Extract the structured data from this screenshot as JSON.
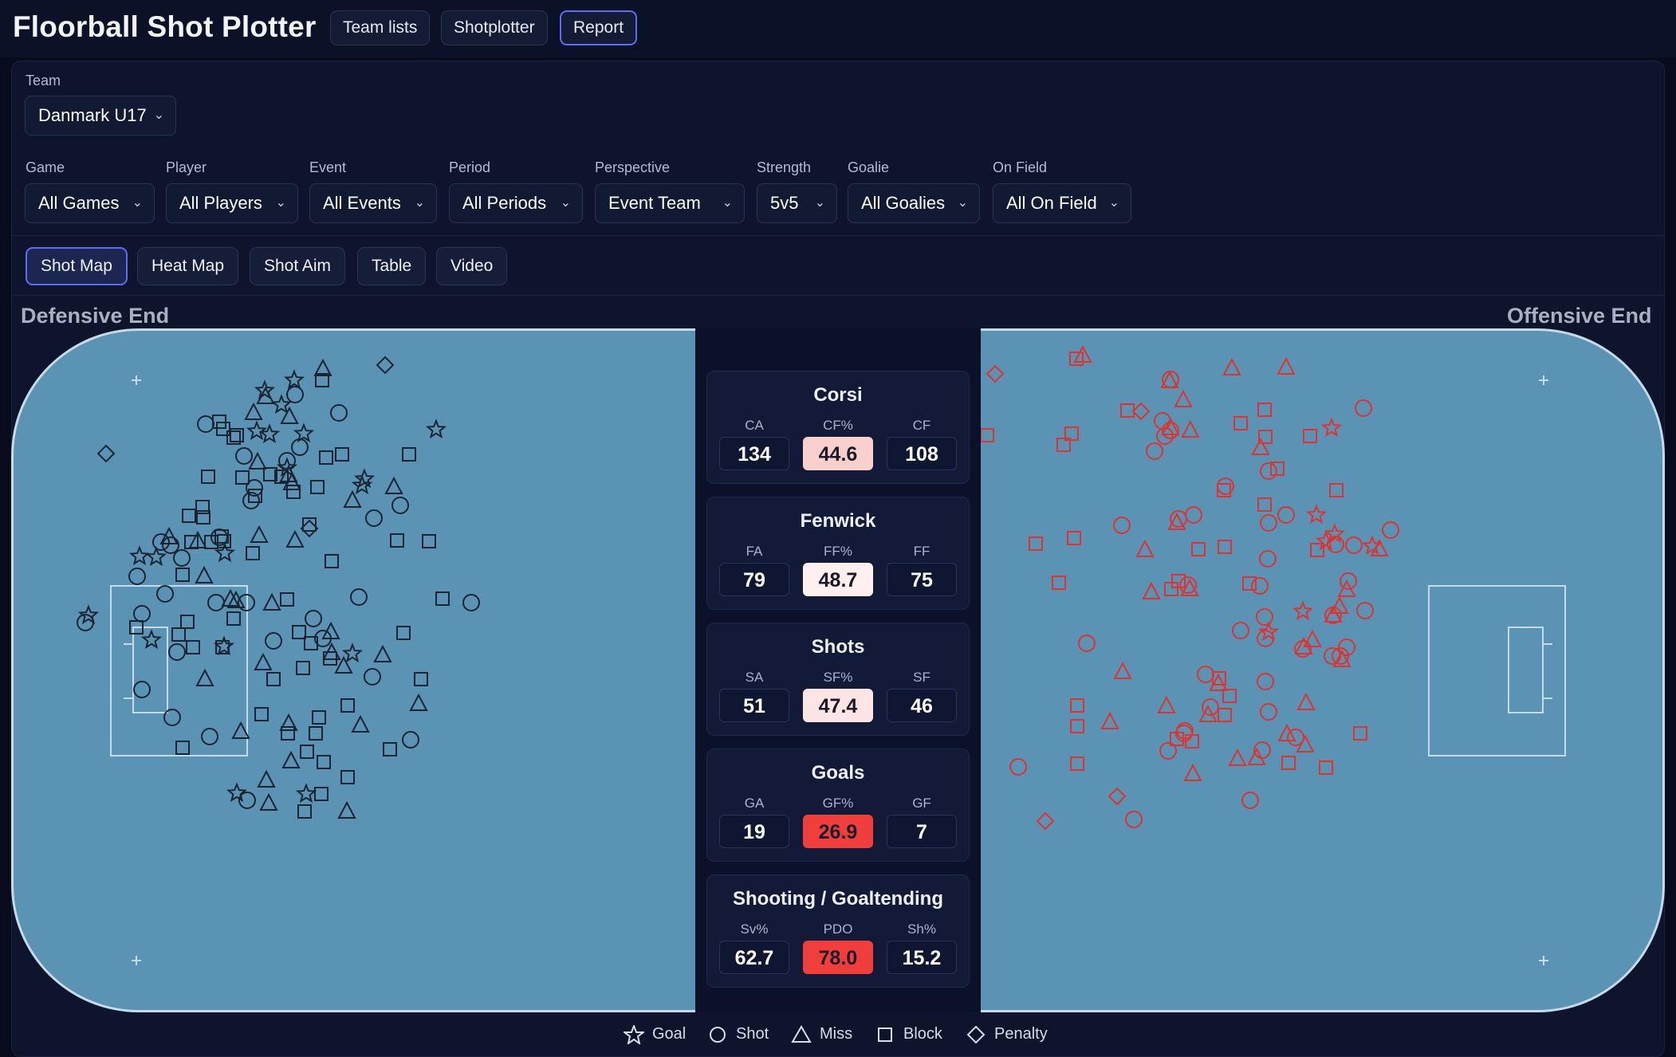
{
  "app": {
    "title": "Floorball Shot Plotter"
  },
  "nav": {
    "items": [
      {
        "label": "Team lists"
      },
      {
        "label": "Shotplotter"
      },
      {
        "label": "Report"
      }
    ],
    "active": "Report"
  },
  "filters": {
    "team": {
      "label": "Team",
      "value": "Danmark U17"
    },
    "game": {
      "label": "Game",
      "value": "All Games"
    },
    "player": {
      "label": "Player",
      "value": "All Players"
    },
    "event": {
      "label": "Event",
      "value": "All Events"
    },
    "period": {
      "label": "Period",
      "value": "All Periods"
    },
    "perspective": {
      "label": "Perspective",
      "value": "Event Team"
    },
    "strength": {
      "label": "Strength",
      "value": "5v5"
    },
    "goalie": {
      "label": "Goalie",
      "value": "All Goalies"
    },
    "onfield": {
      "label": "On Field",
      "value": "All On Field"
    }
  },
  "views": {
    "tabs": [
      {
        "label": "Shot Map"
      },
      {
        "label": "Heat Map"
      },
      {
        "label": "Shot Aim"
      },
      {
        "label": "Table"
      },
      {
        "label": "Video"
      }
    ],
    "active": "Shot Map"
  },
  "map": {
    "left_label": "Defensive End",
    "right_label": "Offensive End",
    "colors": {
      "rink": "#5b93b4",
      "defensive_marker": "#1b2430",
      "offensive_marker": "#e0322f",
      "rink_line": "#c5dbe8"
    }
  },
  "stats": {
    "corsi": {
      "title": "Corsi",
      "left": {
        "label": "CA",
        "value": "134"
      },
      "mid": {
        "label": "CF%",
        "value": "44.6",
        "color": "#fad0cf",
        "text": "#1a1a2a"
      },
      "right": {
        "label": "CF",
        "value": "108"
      }
    },
    "fenwick": {
      "title": "Fenwick",
      "left": {
        "label": "FA",
        "value": "79"
      },
      "mid": {
        "label": "FF%",
        "value": "48.7",
        "color": "#fdf0ef",
        "text": "#1a1a2a"
      },
      "right": {
        "label": "FF",
        "value": "75"
      }
    },
    "shots": {
      "title": "Shots",
      "left": {
        "label": "SA",
        "value": "51"
      },
      "mid": {
        "label": "SF%",
        "value": "47.4",
        "color": "#fce5e4",
        "text": "#1a1a2a"
      },
      "right": {
        "label": "SF",
        "value": "46"
      }
    },
    "goals": {
      "title": "Goals",
      "left": {
        "label": "GA",
        "value": "19"
      },
      "mid": {
        "label": "GF%",
        "value": "26.9",
        "color": "#ef3e3b",
        "text": "#1a1a2a"
      },
      "right": {
        "label": "GF",
        "value": "7"
      }
    },
    "shooting": {
      "title": "Shooting / Goaltending",
      "left": {
        "label": "Sv%",
        "value": "62.7"
      },
      "mid": {
        "label": "PDO",
        "value": "78.0",
        "color": "#ef3e3b",
        "text": "#1a1a2a"
      },
      "right": {
        "label": "Sh%",
        "value": "15.2"
      }
    }
  },
  "legend": [
    {
      "label": "Goal",
      "shape": "star"
    },
    {
      "label": "Shot",
      "shape": "circle"
    },
    {
      "label": "Miss",
      "shape": "triangle"
    },
    {
      "label": "Block",
      "shape": "square"
    },
    {
      "label": "Penalty",
      "shape": "diamond"
    }
  ]
}
